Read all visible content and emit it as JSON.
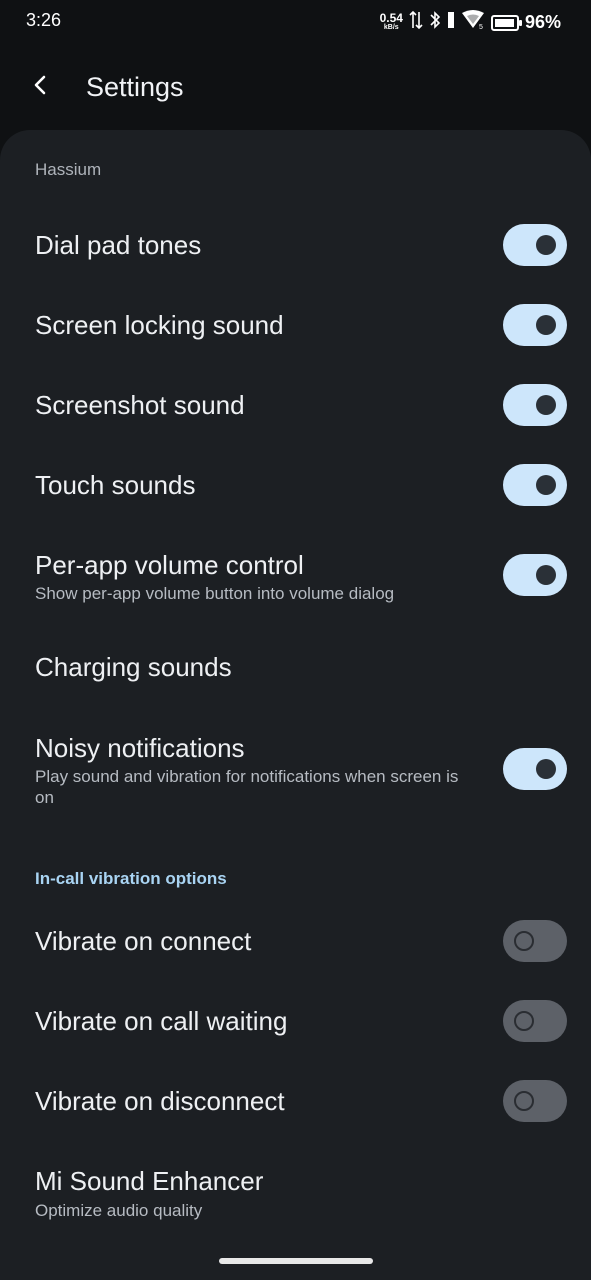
{
  "status_bar": {
    "time": "3:26",
    "net_speed_value": "0.54",
    "net_speed_unit": "kB/s",
    "battery_text": "96%",
    "battery_level": 0.96
  },
  "app_bar": {
    "title": "Settings",
    "back_icon": "chevron-left-icon"
  },
  "section_top_label": "Hassium",
  "items": [
    {
      "title": "Dial pad tones",
      "summary": "",
      "toggle": "on"
    },
    {
      "title": "Screen locking sound",
      "summary": "",
      "toggle": "on"
    },
    {
      "title": "Screenshot sound",
      "summary": "",
      "toggle": "on"
    },
    {
      "title": "Touch sounds",
      "summary": "",
      "toggle": "on"
    },
    {
      "title": "Per-app volume control",
      "summary": "Show per-app volume button into volume dialog",
      "toggle": "on"
    },
    {
      "title": "Charging sounds",
      "summary": "",
      "toggle": "none"
    },
    {
      "title": "Noisy notifications",
      "summary": "Play sound and vibration for notifications when screen is on",
      "toggle": "on"
    }
  ],
  "in_call_section": {
    "header": "In-call vibration options",
    "items": [
      {
        "title": "Vibrate on connect",
        "toggle": "off"
      },
      {
        "title": "Vibrate on call waiting",
        "toggle": "off"
      },
      {
        "title": "Vibrate on disconnect",
        "toggle": "off"
      }
    ]
  },
  "enhancer": {
    "title": "Mi Sound Enhancer",
    "summary": "Optimize audio quality"
  },
  "colors": {
    "accent": "#a9d4f3",
    "switch_on": "#cde6fb",
    "switch_off": "#5d6168",
    "panel_bg": "#1c1f23"
  }
}
